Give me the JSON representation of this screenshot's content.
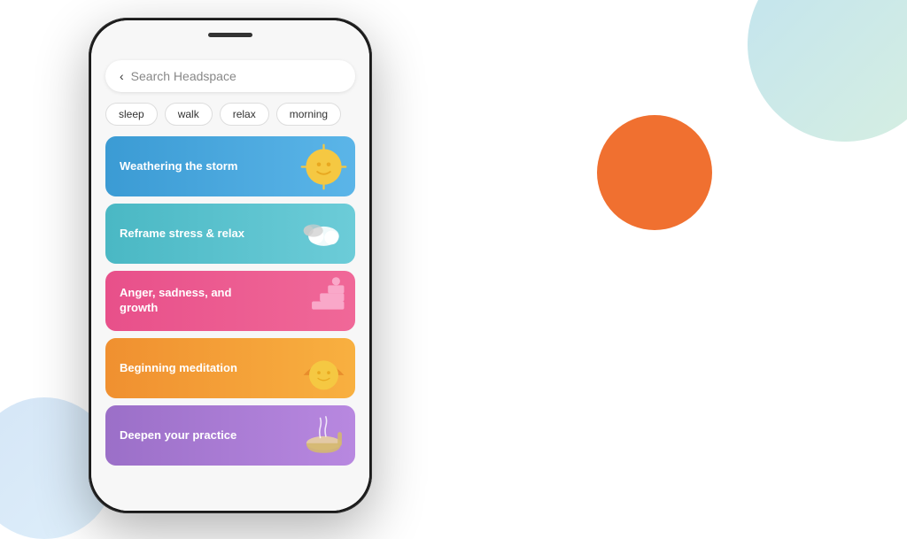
{
  "background": {
    "orange_circle_color": "#f07030",
    "teal_shape_color": "#a8d8e8",
    "blue_shape_color": "#b8d4f0"
  },
  "phone": {
    "search": {
      "placeholder": "Search Headspace",
      "back_arrow": "‹"
    },
    "tags": [
      {
        "label": "sleep",
        "active": false
      },
      {
        "label": "walk",
        "active": false
      },
      {
        "label": "relax",
        "active": false
      },
      {
        "label": "morning",
        "active": false
      }
    ],
    "cards": [
      {
        "title": "Weathering the storm",
        "color_start": "#3b9bd4",
        "color_end": "#5bb5e8",
        "illustration": "sun"
      },
      {
        "title": "Reframe stress & relax",
        "color_start": "#4ab8c4",
        "color_end": "#6cccd8",
        "illustration": "cloud"
      },
      {
        "title": "Anger, sadness, and growth",
        "color_start": "#e8508a",
        "color_end": "#f06898",
        "illustration": "steps"
      },
      {
        "title": "Beginning meditation",
        "color_start": "#f09030",
        "color_end": "#f8b040",
        "illustration": "sun-face"
      },
      {
        "title": "Deepen your practice",
        "color_start": "#9b6fc8",
        "color_end": "#b888e0",
        "illustration": "bowl"
      }
    ]
  }
}
